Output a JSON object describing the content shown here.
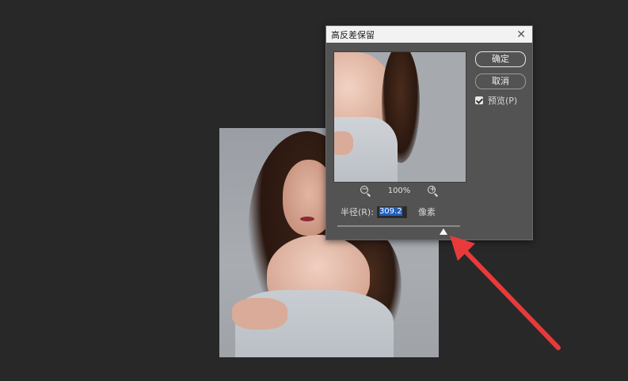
{
  "dialog": {
    "title": "高反差保留",
    "close_icon": "close-icon",
    "ok_label": "确定",
    "cancel_label": "取消",
    "preview_label": "预览(P)",
    "preview_checked": true,
    "zoom_level": "100%",
    "zoom_out_icon": "zoom-out-icon",
    "zoom_in_icon": "zoom-in-icon",
    "radius_label": "半径(R):",
    "radius_value": "309.2",
    "radius_unit": "像素"
  },
  "colors": {
    "background": "#282828",
    "dialog_bg": "#535353",
    "titlebar_bg": "#f2f2f2",
    "selection": "#1f5fbf",
    "annotation_arrow": "#e83a3a"
  }
}
